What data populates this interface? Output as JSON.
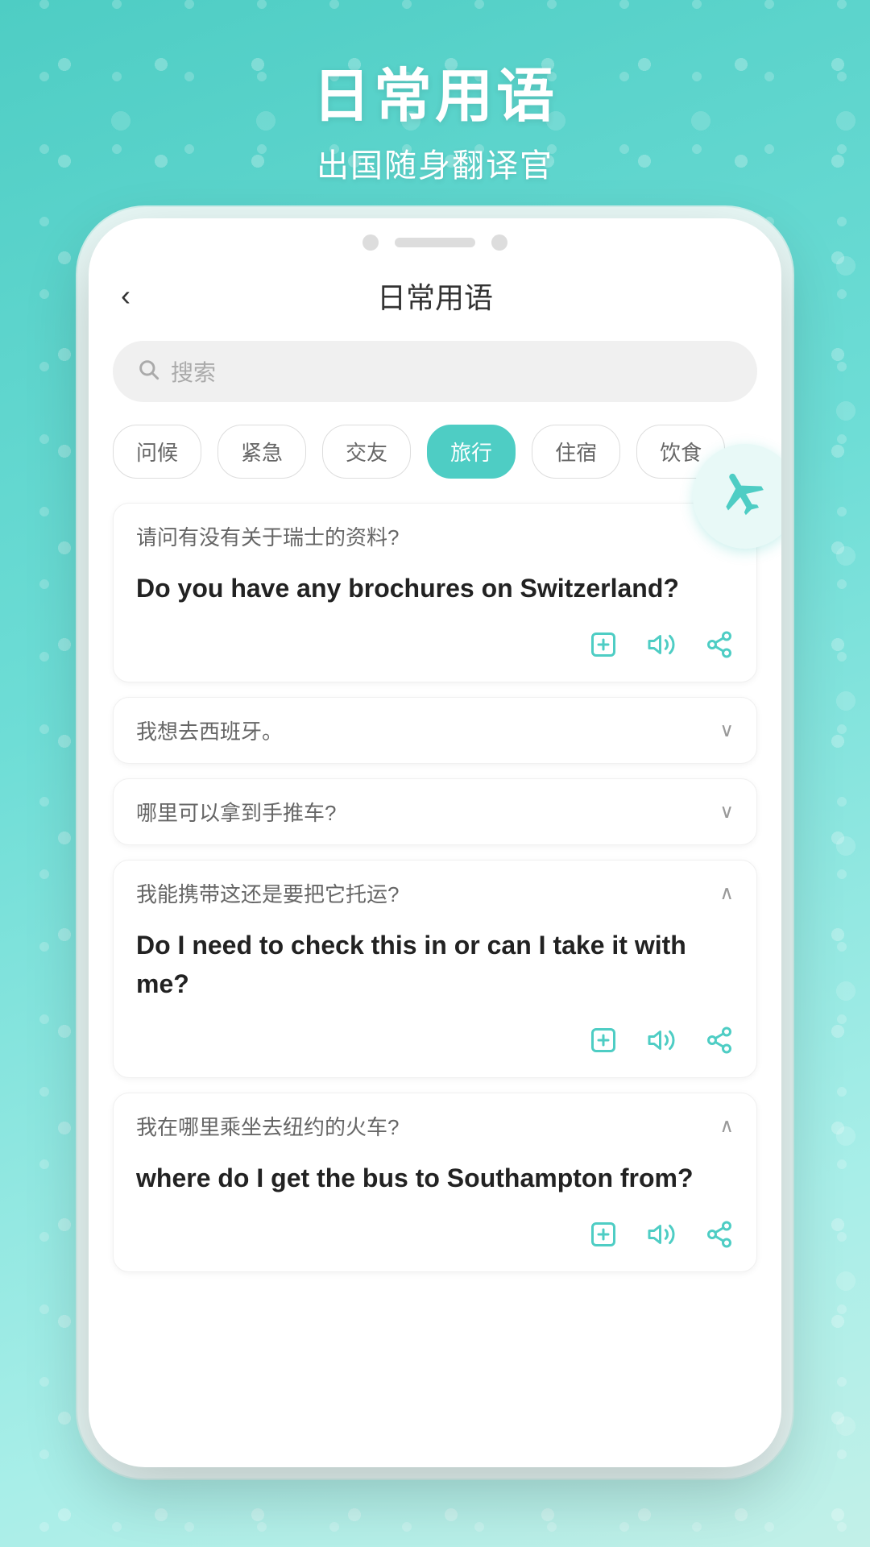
{
  "background": {
    "gradient_start": "#4ecdc4",
    "gradient_end": "#c2f0e8"
  },
  "header": {
    "title": "日常用语",
    "subtitle": "出国随身翻译官"
  },
  "nav": {
    "back_label": "‹",
    "title": "日常用语",
    "search_placeholder": "搜索"
  },
  "categories": [
    {
      "id": "greet",
      "label": "问候",
      "active": false
    },
    {
      "id": "urgent",
      "label": "紧急",
      "active": false
    },
    {
      "id": "social",
      "label": "交友",
      "active": false
    },
    {
      "id": "travel",
      "label": "旅行",
      "active": true
    },
    {
      "id": "stay",
      "label": "住宿",
      "active": false
    },
    {
      "id": "food",
      "label": "饮食",
      "active": false
    }
  ],
  "phrases": [
    {
      "id": 1,
      "chinese": "请问有没有关于瑞士的资料?",
      "english": "Do you have any brochures on Switzerland?",
      "expanded": true,
      "chevron": "∧"
    },
    {
      "id": 2,
      "chinese": "我想去西班牙。",
      "english": "",
      "expanded": false,
      "chevron": "∨"
    },
    {
      "id": 3,
      "chinese": "哪里可以拿到手推车?",
      "english": "",
      "expanded": false,
      "chevron": "∨"
    },
    {
      "id": 4,
      "chinese": "我能携带这还是要把它托运?",
      "english": "Do I need to check this in or can I take it with me?",
      "expanded": true,
      "chevron": "∧"
    },
    {
      "id": 5,
      "chinese": "我在哪里乘坐去纽约的火车?",
      "english": "where do I get the bus to Southampton from?",
      "expanded": true,
      "chevron": "∧"
    }
  ],
  "actions": {
    "add_label": "⊞",
    "sound_label": "🔈",
    "share_label": "share"
  }
}
